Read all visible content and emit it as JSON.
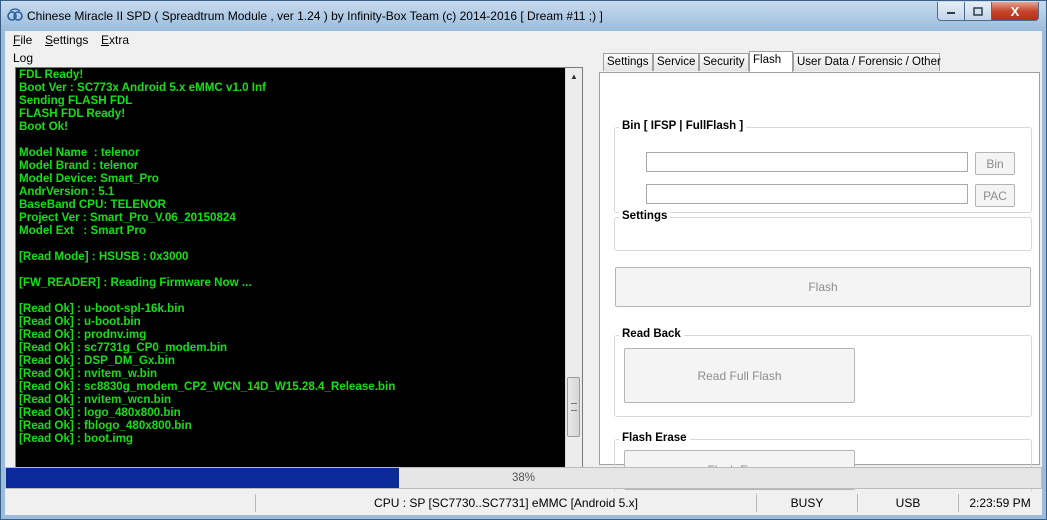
{
  "window": {
    "title": "Chinese Miracle II SPD ( Spreadtrum Module , ver 1.24 ) by Infinity-Box Team (c) 2014-2016 [ Dream #11 ;) ]",
    "close_glyph": "X"
  },
  "menu": [
    {
      "key": "F",
      "rest": "ile"
    },
    {
      "key": "S",
      "rest": "ettings"
    },
    {
      "key": "E",
      "rest": "xtra"
    }
  ],
  "log": {
    "label": "Log",
    "lines": [
      "FDL Ready!",
      "Boot Ver : SC773x Android 5.x eMMC v1.0 Inf",
      "Sending FLASH FDL",
      "FLASH FDL Ready!",
      "Boot Ok!",
      "",
      "Model Name  : telenor",
      "Model Brand : telenor",
      "Model Device: Smart_Pro",
      "AndrVersion : 5.1",
      "BaseBand CPU: TELENOR",
      "Project Ver : Smart_Pro_V.06_20150824",
      "Model Ext   : Smart Pro",
      "",
      "[Read Mode] : HSUSB : 0x3000",
      "",
      "[FW_READER] : Reading Firmware Now ...",
      "",
      "[Read Ok] : u-boot-spl-16k.bin",
      "[Read Ok] : u-boot.bin",
      "[Read Ok] : prodnv.img",
      "[Read Ok] : sc7731g_CP0_modem.bin",
      "[Read Ok] : DSP_DM_Gx.bin",
      "[Read Ok] : nvitem_w.bin",
      "[Read Ok] : sc8830g_modem_CP2_WCN_14D_W15.28.4_Release.bin",
      "[Read Ok] : nvitem_wcn.bin",
      "[Read Ok] : logo_480x800.bin",
      "[Read Ok] : fblogo_480x800.bin",
      "[Read Ok] : boot.img"
    ]
  },
  "tabs": [
    {
      "label": "Settings"
    },
    {
      "label": "Service"
    },
    {
      "label": "Security"
    },
    {
      "label": "Flash"
    },
    {
      "label": "User Data / Forensic / Other"
    }
  ],
  "flash_tab": {
    "bin_group_label": "Bin  [ IFSP | FullFlash ]",
    "bin_button": "Bin",
    "pac_button": "PAC",
    "settings_group_label": "Settings",
    "flash_button": "Flash",
    "readback_group_label": "Read Back",
    "read_full_flash_button": "Read Full Flash",
    "flash_erase_group_label": "Flash Erase",
    "flash_erase_button": "Flash Erase"
  },
  "progress": {
    "text": "38%",
    "value": 0.38
  },
  "status": {
    "cpu": "CPU : SP [SC7730..SC7731] eMMC [Android 5.x]",
    "state": "BUSY",
    "connection": "USB",
    "time": "2:23:59 PM"
  },
  "colors": {
    "log_text": "#12e012",
    "progress_fill": "#0a2a9a"
  }
}
